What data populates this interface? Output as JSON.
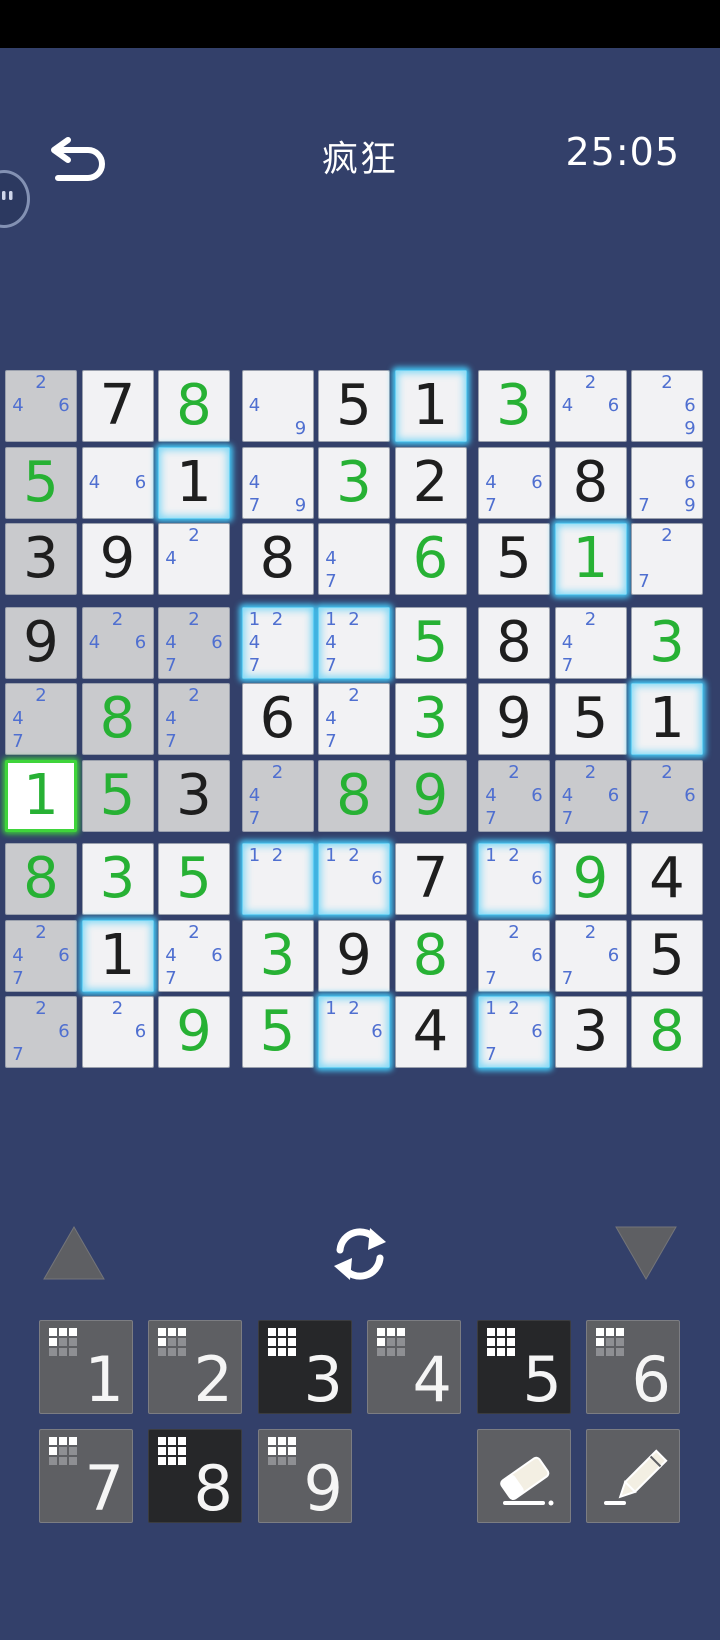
{
  "header": {
    "title": "疯狂",
    "timer": "25:05",
    "back_icon": "undo-arrow-icon"
  },
  "board": {
    "cells": [
      [
        {
          "notes": [
            "2",
            "4",
            "6"
          ]
        },
        {
          "v": "7"
        },
        {
          "v": "8",
          "user": true
        },
        {
          "notes": [
            "4",
            "9"
          ]
        },
        {
          "v": "5"
        },
        {
          "v": "1"
        },
        {
          "v": "3",
          "user": true
        },
        {
          "notes": [
            "2",
            "4",
            "6"
          ]
        },
        {
          "notes": [
            "2",
            "6",
            "9"
          ]
        }
      ],
      [
        {
          "v": "5",
          "user": true
        },
        {
          "notes": [
            "4",
            "6"
          ]
        },
        {
          "v": "1"
        },
        {
          "notes": [
            "4",
            "7",
            "9"
          ]
        },
        {
          "v": "3",
          "user": true
        },
        {
          "v": "2"
        },
        {
          "notes": [
            "4",
            "6",
            "7"
          ]
        },
        {
          "v": "8"
        },
        {
          "notes": [
            "6",
            "7",
            "9"
          ]
        }
      ],
      [
        {
          "v": "3"
        },
        {
          "v": "9"
        },
        {
          "notes": [
            "2",
            "4"
          ]
        },
        {
          "v": "8"
        },
        {
          "notes": [
            "4",
            "7"
          ]
        },
        {
          "v": "6",
          "user": true
        },
        {
          "v": "5"
        },
        {
          "v": "1",
          "user": true
        },
        {
          "notes": [
            "2",
            "7"
          ]
        }
      ],
      [
        {
          "v": "9"
        },
        {
          "notes": [
            "2",
            "4",
            "6"
          ]
        },
        {
          "notes": [
            "2",
            "4",
            "6",
            "7"
          ]
        },
        {
          "notes": [
            "1",
            "2",
            "4",
            "7"
          ]
        },
        {
          "notes": [
            "1",
            "2",
            "4",
            "7"
          ]
        },
        {
          "v": "5",
          "user": true
        },
        {
          "v": "8"
        },
        {
          "notes": [
            "2",
            "4",
            "7"
          ]
        },
        {
          "v": "3",
          "user": true
        }
      ],
      [
        {
          "notes": [
            "2",
            "4",
            "7"
          ]
        },
        {
          "v": "8",
          "user": true
        },
        {
          "notes": [
            "2",
            "4",
            "7"
          ]
        },
        {
          "v": "6"
        },
        {
          "notes": [
            "2",
            "4",
            "7"
          ]
        },
        {
          "v": "3",
          "user": true
        },
        {
          "v": "9"
        },
        {
          "v": "5"
        },
        {
          "v": "1"
        }
      ],
      [
        {
          "v": "1",
          "user": true
        },
        {
          "v": "5",
          "user": true
        },
        {
          "v": "3"
        },
        {
          "notes": [
            "2",
            "4",
            "7"
          ]
        },
        {
          "v": "8",
          "user": true
        },
        {
          "v": "9",
          "user": true
        },
        {
          "notes": [
            "2",
            "4",
            "6",
            "7"
          ]
        },
        {
          "notes": [
            "2",
            "4",
            "6",
            "7"
          ]
        },
        {
          "notes": [
            "2",
            "6",
            "7"
          ]
        }
      ],
      [
        {
          "v": "8",
          "user": true
        },
        {
          "v": "3",
          "user": true
        },
        {
          "v": "5",
          "user": true
        },
        {
          "notes": [
            "1",
            "2"
          ]
        },
        {
          "notes": [
            "1",
            "2",
            "6"
          ]
        },
        {
          "v": "7"
        },
        {
          "notes": [
            "1",
            "2",
            "6"
          ]
        },
        {
          "v": "9",
          "user": true
        },
        {
          "v": "4"
        }
      ],
      [
        {
          "notes": [
            "2",
            "4",
            "6",
            "7"
          ]
        },
        {
          "v": "1"
        },
        {
          "notes": [
            "2",
            "4",
            "6",
            "7"
          ]
        },
        {
          "v": "3",
          "user": true
        },
        {
          "v": "9"
        },
        {
          "v": "8",
          "user": true
        },
        {
          "notes": [
            "2",
            "6",
            "7"
          ]
        },
        {
          "notes": [
            "2",
            "6",
            "7"
          ]
        },
        {
          "v": "5"
        }
      ],
      [
        {
          "notes": [
            "2",
            "6",
            "7"
          ]
        },
        {
          "notes": [
            "2",
            "6"
          ]
        },
        {
          "v": "9",
          "user": true
        },
        {
          "v": "5",
          "user": true
        },
        {
          "notes": [
            "1",
            "2",
            "6"
          ]
        },
        {
          "v": "4"
        },
        {
          "notes": [
            "1",
            "2",
            "6",
            "7"
          ]
        },
        {
          "v": "3"
        },
        {
          "v": "8",
          "user": true
        }
      ]
    ],
    "shaded": [
      [
        0,
        0
      ],
      [
        1,
        0
      ],
      [
        2,
        0
      ],
      [
        3,
        0
      ],
      [
        4,
        0
      ],
      [
        6,
        0
      ],
      [
        7,
        0
      ],
      [
        8,
        0
      ],
      [
        3,
        1
      ],
      [
        4,
        1
      ],
      [
        5,
        1
      ],
      [
        3,
        2
      ],
      [
        4,
        2
      ],
      [
        5,
        2
      ],
      [
        5,
        3
      ],
      [
        5,
        4
      ],
      [
        5,
        5
      ],
      [
        5,
        6
      ],
      [
        5,
        7
      ],
      [
        5,
        8
      ]
    ],
    "highlighted": [
      [
        0,
        5
      ],
      [
        1,
        2
      ],
      [
        2,
        7
      ],
      [
        3,
        3
      ],
      [
        3,
        4
      ],
      [
        4,
        8
      ],
      [
        6,
        3
      ],
      [
        6,
        4
      ],
      [
        6,
        6
      ],
      [
        7,
        1
      ],
      [
        8,
        4
      ],
      [
        8,
        6
      ]
    ],
    "selected": [
      5,
      0
    ]
  },
  "controls": {
    "up_icon": "triangle-up-icon",
    "swap_icon": "swap-arrows-icon",
    "down_icon": "triangle-down-icon"
  },
  "keypad": {
    "digits": [
      {
        "label": "1",
        "dark": false,
        "grid_filled": 4
      },
      {
        "label": "2",
        "dark": false,
        "grid_filled": 4
      },
      {
        "label": "3",
        "dark": true,
        "grid_filled": 9
      },
      {
        "label": "4",
        "dark": false,
        "grid_filled": 4
      },
      {
        "label": "5",
        "dark": true,
        "grid_filled": 9
      },
      {
        "label": "6",
        "dark": false,
        "grid_filled": 4
      },
      {
        "label": "7",
        "dark": false,
        "grid_filled": 4
      },
      {
        "label": "8",
        "dark": true,
        "grid_filled": 9
      },
      {
        "label": "9",
        "dark": false,
        "grid_filled": 6
      }
    ],
    "eraser_icon": "eraser-icon",
    "pencil_icon": "pencil-icon"
  }
}
